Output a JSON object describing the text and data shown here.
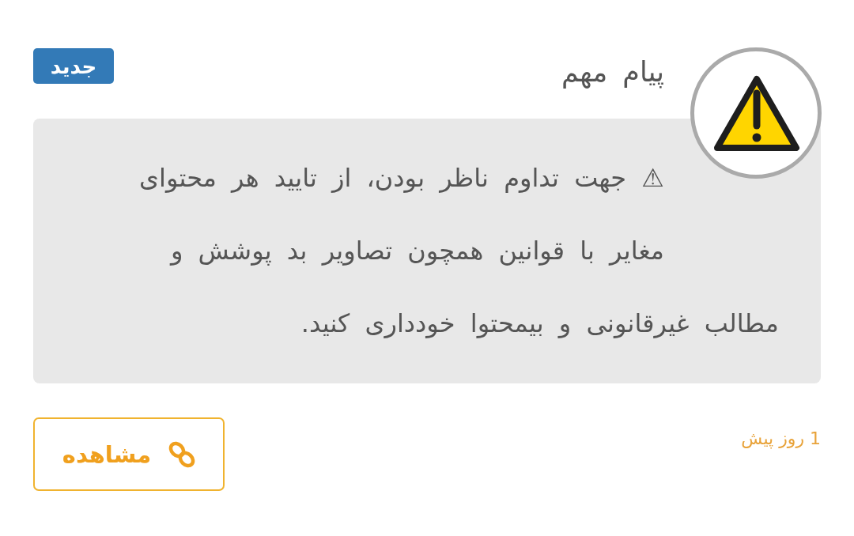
{
  "notice": {
    "badge": "جدید",
    "title": "پیام مهم",
    "message": "⚠ جهت تداوم ناظر بودن، از تایید هر محتوای مغایر با قوانین همچون تصاویر بد پوشش و مطالب غیرقانونی و بیمحتوا خودداری کنید.",
    "time": "1 روز پیش",
    "action": {
      "label": "مشاهده"
    }
  }
}
